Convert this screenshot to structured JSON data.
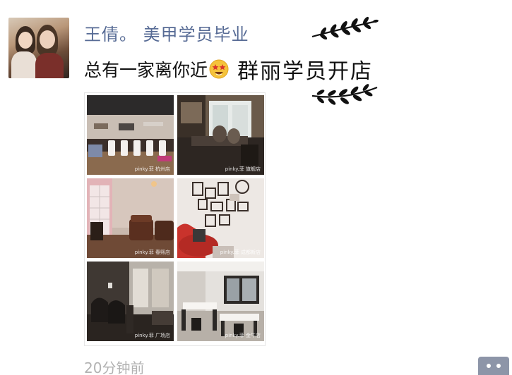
{
  "post": {
    "author": "王倩。 美甲学员毕业",
    "text_prefix": "总有一家离你近",
    "emoji": "star-struck-emoji",
    "headline": "群丽学员开店",
    "timestamp": "20分钟前",
    "more_icon": "more-dots-icon"
  },
  "colors": {
    "name_link": "#576b95",
    "timestamp": "#b2b2b2",
    "more_button": "#8d95a8"
  },
  "photos": [
    {
      "caption": "pinky.菲 杭州店"
    },
    {
      "caption": "pinky.菲 旗舰店"
    },
    {
      "caption": "pinky.菲 春熙店"
    },
    {
      "caption": "pinky.菲 成都新店"
    },
    {
      "caption": "pinky.菲 广场店"
    },
    {
      "caption": "pinky.菲 金牛店"
    }
  ]
}
